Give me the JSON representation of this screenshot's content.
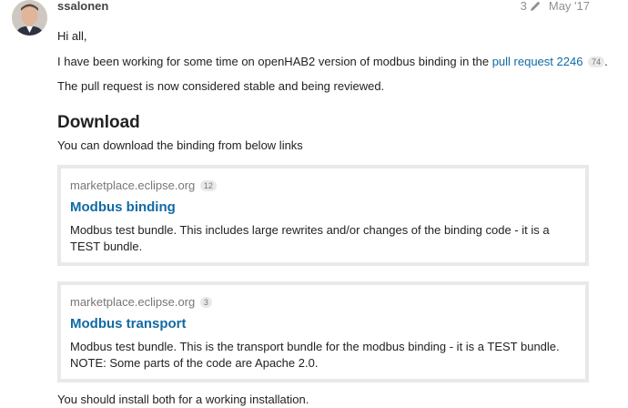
{
  "post": {
    "username": "ssalonen",
    "edit_count": "3",
    "date": "May '17",
    "greeting": "Hi all,",
    "intro_text": "I have been working for some time on openHAB2 version of modbus binding in the",
    "pr_link_text": "pull request 2246",
    "pr_link_count": "74",
    "intro_end": ".",
    "status_text": "The pull request is now considered stable and being reviewed.",
    "download_heading": "Download",
    "download_intro": "You can download the binding from below links",
    "install_note": "You should install both for a working installation."
  },
  "oneboxes": [
    {
      "source": "marketplace.eclipse.org",
      "count": "12",
      "title": "Modbus binding",
      "description": "Modbus test bundle. This includes large rewrites and/or changes of the binding code - it is a TEST bundle."
    },
    {
      "source": "marketplace.eclipse.org",
      "count": "3",
      "title": "Modbus transport",
      "description": "Modbus test bundle. This is the transport bundle for the modbus binding - it is a TEST bundle. NOTE: Some parts of the code are Apache 2.0."
    }
  ]
}
